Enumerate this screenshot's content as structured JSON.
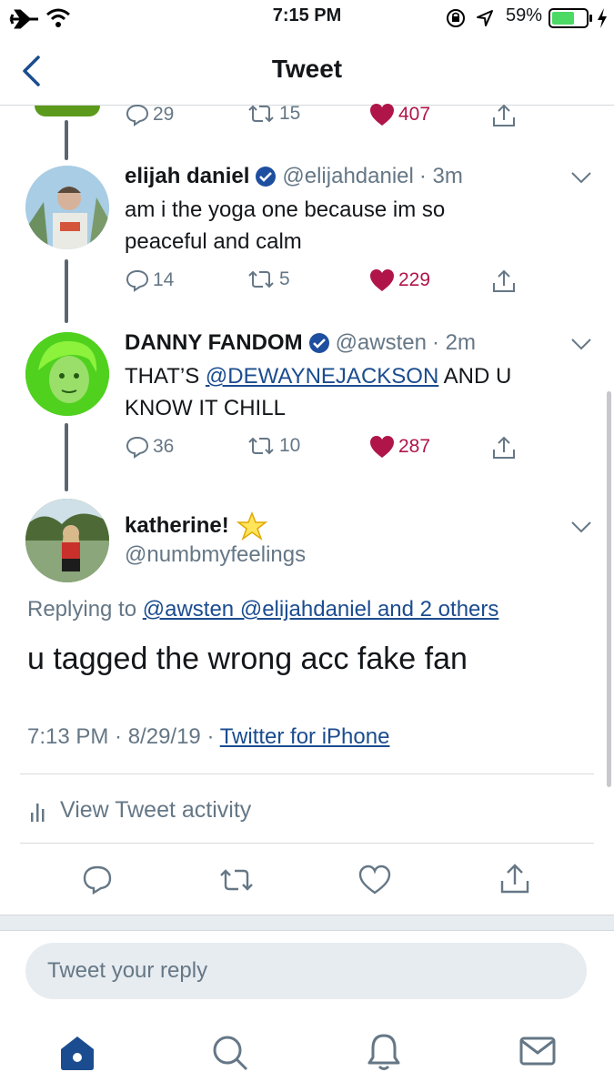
{
  "status_bar": {
    "time": "7:15 PM",
    "battery_percent": "59%"
  },
  "nav": {
    "title": "Tweet"
  },
  "thread": [
    {
      "counts": {
        "reply": "29",
        "retweet": "15",
        "like": "407"
      }
    },
    {
      "name": "elijah daniel",
      "handle": "@elijahdaniel",
      "time": "· 3m",
      "body_line1": "am i the yoga one because im so",
      "body_line2": "peaceful and calm",
      "counts": {
        "reply": "14",
        "retweet": "5",
        "like": "229"
      }
    },
    {
      "name": "DANNY FANDOM",
      "handle": "@awsten",
      "time": "· 2m",
      "body_prefix": "THAT’S ",
      "body_mention": "@DEWAYNEJACKSON",
      "body_suffix": " AND U",
      "body_line2": "KNOW IT CHILL",
      "counts": {
        "reply": "36",
        "retweet": "10",
        "like": "287"
      }
    }
  ],
  "main_tweet": {
    "name": "katherine!",
    "handle": "@numbmyfeelings",
    "replying_prefix": "Replying to ",
    "replying_links": "@awsten @elijahdaniel and 2 others",
    "text": "u tagged the wrong acc fake fan",
    "timestamp": "7:13 PM · 8/29/19 · ",
    "source": "Twitter for iPhone",
    "activity_label": "View Tweet activity"
  },
  "reply_box": {
    "placeholder": "Tweet your reply"
  },
  "colors": {
    "accent": "#1b4c8f",
    "liked": "#b0154a",
    "verified": "#1d4ea0",
    "secondary": "#657786"
  },
  "icons": [
    "airplane-icon",
    "wifi-icon",
    "lock-rotation-icon",
    "location-icon",
    "battery-icon",
    "charging-icon",
    "back-chevron-icon",
    "reply-icon",
    "retweet-icon",
    "heart-icon",
    "share-icon",
    "verified-badge-icon",
    "star-icon",
    "activity-bars-icon",
    "home-icon",
    "search-icon",
    "notifications-icon",
    "messages-icon"
  ]
}
